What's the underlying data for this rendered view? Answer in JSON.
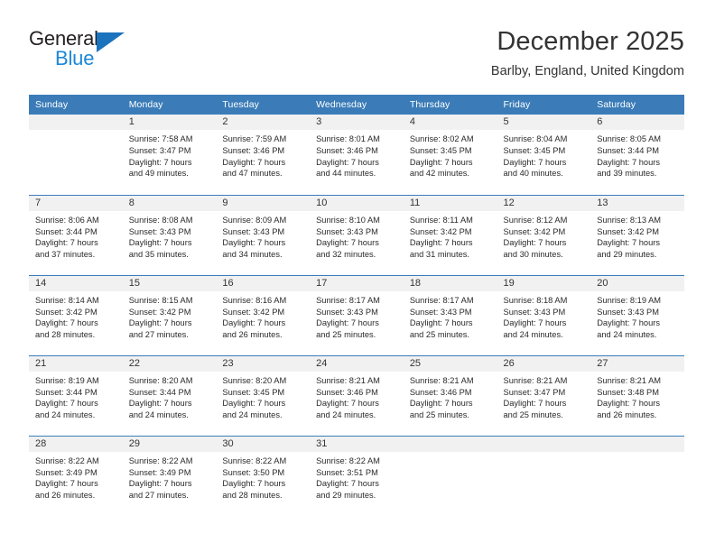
{
  "brand": {
    "name_top": "General",
    "name_bottom": "Blue",
    "accent_color": "#1b87d8",
    "triangle_color": "#1b72bd"
  },
  "header": {
    "title": "December 2025",
    "location": "Barlby, England, United Kingdom"
  },
  "theme": {
    "header_blue": "#3b7cb8",
    "daynum_band": "#f1f1f1",
    "text": "#222222"
  },
  "calendar": {
    "weekday_headers": [
      "Sunday",
      "Monday",
      "Tuesday",
      "Wednesday",
      "Thursday",
      "Friday",
      "Saturday"
    ],
    "weeks": [
      [
        {
          "day": "",
          "details": ""
        },
        {
          "day": "1",
          "details": "Sunrise: 7:58 AM\nSunset: 3:47 PM\nDaylight: 7 hours\nand 49 minutes."
        },
        {
          "day": "2",
          "details": "Sunrise: 7:59 AM\nSunset: 3:46 PM\nDaylight: 7 hours\nand 47 minutes."
        },
        {
          "day": "3",
          "details": "Sunrise: 8:01 AM\nSunset: 3:46 PM\nDaylight: 7 hours\nand 44 minutes."
        },
        {
          "day": "4",
          "details": "Sunrise: 8:02 AM\nSunset: 3:45 PM\nDaylight: 7 hours\nand 42 minutes."
        },
        {
          "day": "5",
          "details": "Sunrise: 8:04 AM\nSunset: 3:45 PM\nDaylight: 7 hours\nand 40 minutes."
        },
        {
          "day": "6",
          "details": "Sunrise: 8:05 AM\nSunset: 3:44 PM\nDaylight: 7 hours\nand 39 minutes."
        }
      ],
      [
        {
          "day": "7",
          "details": "Sunrise: 8:06 AM\nSunset: 3:44 PM\nDaylight: 7 hours\nand 37 minutes."
        },
        {
          "day": "8",
          "details": "Sunrise: 8:08 AM\nSunset: 3:43 PM\nDaylight: 7 hours\nand 35 minutes."
        },
        {
          "day": "9",
          "details": "Sunrise: 8:09 AM\nSunset: 3:43 PM\nDaylight: 7 hours\nand 34 minutes."
        },
        {
          "day": "10",
          "details": "Sunrise: 8:10 AM\nSunset: 3:43 PM\nDaylight: 7 hours\nand 32 minutes."
        },
        {
          "day": "11",
          "details": "Sunrise: 8:11 AM\nSunset: 3:42 PM\nDaylight: 7 hours\nand 31 minutes."
        },
        {
          "day": "12",
          "details": "Sunrise: 8:12 AM\nSunset: 3:42 PM\nDaylight: 7 hours\nand 30 minutes."
        },
        {
          "day": "13",
          "details": "Sunrise: 8:13 AM\nSunset: 3:42 PM\nDaylight: 7 hours\nand 29 minutes."
        }
      ],
      [
        {
          "day": "14",
          "details": "Sunrise: 8:14 AM\nSunset: 3:42 PM\nDaylight: 7 hours\nand 28 minutes."
        },
        {
          "day": "15",
          "details": "Sunrise: 8:15 AM\nSunset: 3:42 PM\nDaylight: 7 hours\nand 27 minutes."
        },
        {
          "day": "16",
          "details": "Sunrise: 8:16 AM\nSunset: 3:42 PM\nDaylight: 7 hours\nand 26 minutes."
        },
        {
          "day": "17",
          "details": "Sunrise: 8:17 AM\nSunset: 3:43 PM\nDaylight: 7 hours\nand 25 minutes."
        },
        {
          "day": "18",
          "details": "Sunrise: 8:17 AM\nSunset: 3:43 PM\nDaylight: 7 hours\nand 25 minutes."
        },
        {
          "day": "19",
          "details": "Sunrise: 8:18 AM\nSunset: 3:43 PM\nDaylight: 7 hours\nand 24 minutes."
        },
        {
          "day": "20",
          "details": "Sunrise: 8:19 AM\nSunset: 3:43 PM\nDaylight: 7 hours\nand 24 minutes."
        }
      ],
      [
        {
          "day": "21",
          "details": "Sunrise: 8:19 AM\nSunset: 3:44 PM\nDaylight: 7 hours\nand 24 minutes."
        },
        {
          "day": "22",
          "details": "Sunrise: 8:20 AM\nSunset: 3:44 PM\nDaylight: 7 hours\nand 24 minutes."
        },
        {
          "day": "23",
          "details": "Sunrise: 8:20 AM\nSunset: 3:45 PM\nDaylight: 7 hours\nand 24 minutes."
        },
        {
          "day": "24",
          "details": "Sunrise: 8:21 AM\nSunset: 3:46 PM\nDaylight: 7 hours\nand 24 minutes."
        },
        {
          "day": "25",
          "details": "Sunrise: 8:21 AM\nSunset: 3:46 PM\nDaylight: 7 hours\nand 25 minutes."
        },
        {
          "day": "26",
          "details": "Sunrise: 8:21 AM\nSunset: 3:47 PM\nDaylight: 7 hours\nand 25 minutes."
        },
        {
          "day": "27",
          "details": "Sunrise: 8:21 AM\nSunset: 3:48 PM\nDaylight: 7 hours\nand 26 minutes."
        }
      ],
      [
        {
          "day": "28",
          "details": "Sunrise: 8:22 AM\nSunset: 3:49 PM\nDaylight: 7 hours\nand 26 minutes."
        },
        {
          "day": "29",
          "details": "Sunrise: 8:22 AM\nSunset: 3:49 PM\nDaylight: 7 hours\nand 27 minutes."
        },
        {
          "day": "30",
          "details": "Sunrise: 8:22 AM\nSunset: 3:50 PM\nDaylight: 7 hours\nand 28 minutes."
        },
        {
          "day": "31",
          "details": "Sunrise: 8:22 AM\nSunset: 3:51 PM\nDaylight: 7 hours\nand 29 minutes."
        },
        {
          "day": "",
          "details": ""
        },
        {
          "day": "",
          "details": ""
        },
        {
          "day": "",
          "details": ""
        }
      ]
    ]
  }
}
